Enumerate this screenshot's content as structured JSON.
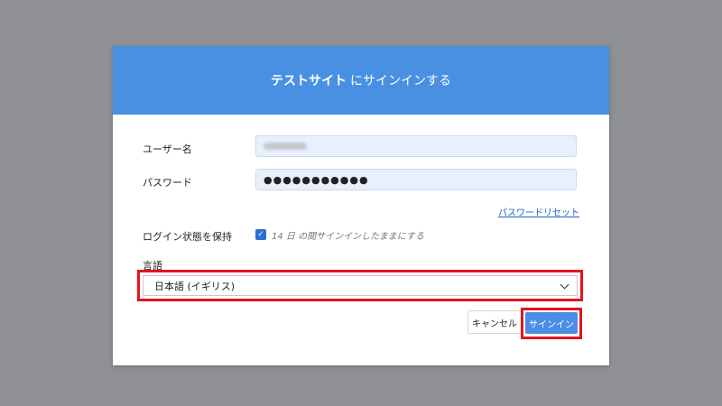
{
  "dialog": {
    "title_site": "テストサイト",
    "title_rest": "にサインインする"
  },
  "form": {
    "username_label": "ユーザー名",
    "password_label": "パスワード",
    "password_value": "●●●●●●●●●●●",
    "reset_link": "パスワードリセット",
    "keep_label": "ログイン状態を保持",
    "keep_checked": true,
    "keep_text": "14 日 の間サインインしたままにする",
    "language_label": "言語",
    "language_value": "日本語 (イギリス)"
  },
  "buttons": {
    "cancel": "キャンセル",
    "signin": "サインイン"
  },
  "colors": {
    "header": "#4a90e2",
    "highlight": "#e3141e",
    "primary_button": "#4a8ee6",
    "backdrop": "#8f9093"
  },
  "icons": {
    "checkbox": "check-icon",
    "select": "chevron-down-icon"
  }
}
